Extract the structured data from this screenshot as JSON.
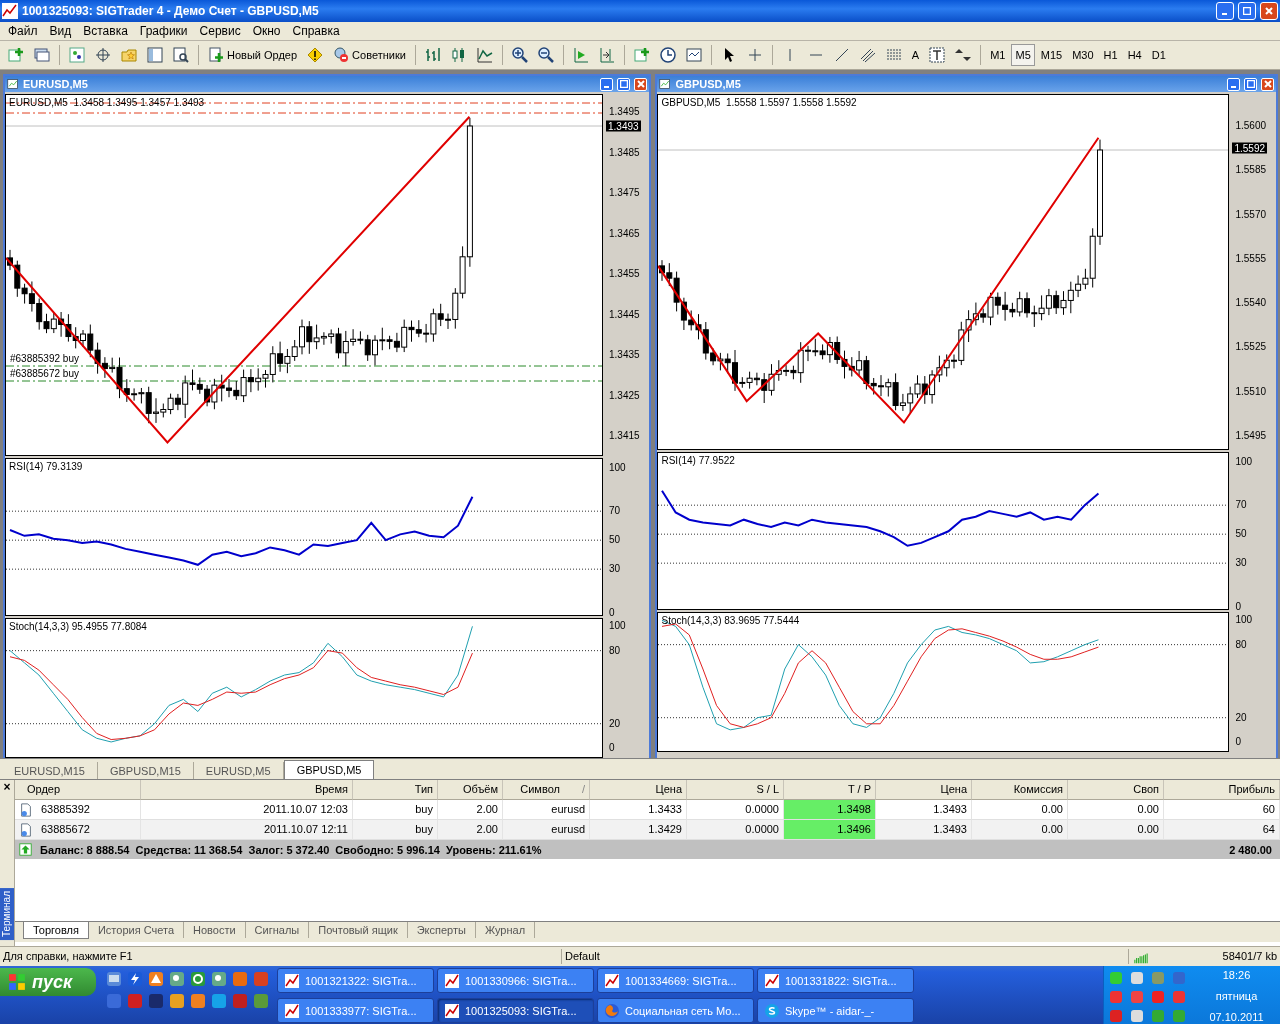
{
  "window": {
    "title": "1001325093: SIGTrader 4 - Демо Счет - GBPUSD,M5"
  },
  "menu": [
    "Файл",
    "Вид",
    "Вставка",
    "Графики",
    "Сервис",
    "Окно",
    "Справка"
  ],
  "toolbar": {
    "new_order": "Новый Ордер",
    "advisors": "Советники",
    "fonts_label": "A",
    "timeframes": [
      {
        "label": "M1",
        "selected": false
      },
      {
        "label": "M5",
        "selected": true
      },
      {
        "label": "M15",
        "selected": false
      },
      {
        "label": "M30",
        "selected": false
      },
      {
        "label": "H1",
        "selected": false
      },
      {
        "label": "H4",
        "selected": false
      },
      {
        "label": "D1",
        "selected": false
      }
    ]
  },
  "charts": [
    {
      "title": "EURUSD,M5",
      "header": "EURUSD,M5  1.3458 1.3495 1.3457 1.3493",
      "price_labels": [
        "1.3495",
        "1.3485",
        "1.3475",
        "1.3465",
        "1.3455",
        "1.3445",
        "1.3435",
        "1.3425",
        "1.3415"
      ],
      "current_price": "1.3493",
      "order_lines": [
        "#63885392 buy",
        "#63885672 buy"
      ],
      "rsi": {
        "header": "RSI(14) 79.3139",
        "chart_data": {
          "type": "line",
          "grid": true,
          "ylim": [
            -3,
            106
          ],
          "yticks": [
            {
              "value": 100,
              "label": "100"
            },
            {
              "value": 70,
              "label": "70"
            },
            {
              "value": 50,
              "label": "50"
            },
            {
              "value": 30,
              "label": "30"
            },
            {
              "value": 0,
              "label": "0"
            }
          ],
          "series": [
            {
              "color": "#0000cc",
              "values": [
                57,
                53,
                54,
                51,
                50,
                48,
                49,
                47,
                44,
                42,
                40,
                38,
                36,
                33,
                40,
                42,
                39,
                41,
                45,
                43,
                40,
                47,
                46,
                48,
                50,
                62,
                50,
                54,
                56,
                53,
                52,
                60,
                80
              ]
            }
          ]
        }
      },
      "stoch": {
        "header": "Stoch(14,3,3) 95.4955 77.8084",
        "chart_data": {
          "type": "line",
          "grid": true,
          "ylim": [
            -9,
            106
          ],
          "yticks": [
            {
              "value": 100,
              "label": "100"
            },
            {
              "value": 80,
              "label": "80"
            },
            {
              "value": 20,
              "label": "20"
            },
            {
              "value": 0,
              "label": "0"
            }
          ],
          "series": [
            {
              "color": "#20a0b0",
              "values": [
                80,
                70,
                60,
                45,
                30,
                15,
                8,
                5,
                8,
                10,
                20,
                35,
                40,
                30,
                45,
                50,
                42,
                48,
                55,
                60,
                62,
                70,
                86,
                75,
                60,
                55,
                52,
                50,
                48,
                45,
                42,
                60,
                100
              ]
            },
            {
              "color": "#e02020",
              "values": [
                75,
                72,
                64,
                52,
                40,
                25,
                12,
                7,
                8,
                10,
                15,
                28,
                37,
                35,
                40,
                46,
                45,
                46,
                52,
                57,
                60,
                66,
                80,
                78,
                66,
                58,
                55,
                52,
                50,
                47,
                44,
                50,
                78
              ]
            }
          ]
        }
      }
    },
    {
      "title": "GBPUSD,M5",
      "header": "GBPUSD,M5  1.5558 1.5597 1.5558 1.5592",
      "price_labels": [
        "1.5600",
        "1.5585",
        "1.5570",
        "1.5555",
        "1.5540",
        "1.5525",
        "1.5510",
        "1.5495"
      ],
      "current_price": "1.5592",
      "rsi": {
        "header": "RSI(14) 77.9522",
        "chart_data": {
          "type": "line",
          "grid": true,
          "ylim": [
            -3,
            106
          ],
          "yticks": [
            {
              "value": 100,
              "label": "100"
            },
            {
              "value": 70,
              "label": "70"
            },
            {
              "value": 50,
              "label": "50"
            },
            {
              "value": 30,
              "label": "30"
            },
            {
              "value": 0,
              "label": "0"
            }
          ],
          "series": [
            {
              "color": "#0000cc",
              "values": [
                80,
                65,
                60,
                58,
                57,
                56,
                60,
                57,
                55,
                58,
                56,
                60,
                58,
                57,
                56,
                55,
                52,
                48,
                42,
                44,
                48,
                52,
                60,
                62,
                66,
                64,
                62,
                65,
                60,
                62,
                60,
                70,
                78
              ]
            }
          ]
        }
      },
      "stoch": {
        "header": "Stoch(14,3,3) 83.9695 77.5444",
        "chart_data": {
          "type": "line",
          "grid": true,
          "ylim": [
            -9,
            106
          ],
          "yticks": [
            {
              "value": 100,
              "label": "100"
            },
            {
              "value": 80,
              "label": "80"
            },
            {
              "value": 20,
              "label": "20"
            },
            {
              "value": 0,
              "label": "0"
            }
          ],
          "series": [
            {
              "color": "#20a0b0",
              "values": [
                100,
                95,
                80,
                45,
                15,
                10,
                12,
                20,
                22,
                60,
                80,
                70,
                55,
                30,
                15,
                12,
                20,
                40,
                65,
                80,
                92,
                95,
                90,
                88,
                85,
                80,
                75,
                65,
                66,
                70,
                75,
                80,
                84
              ]
            },
            {
              "color": "#e02020",
              "values": [
                95,
                97,
                88,
                60,
                30,
                15,
                12,
                15,
                20,
                40,
                65,
                75,
                65,
                45,
                25,
                15,
                15,
                30,
                50,
                70,
                85,
                92,
                93,
                90,
                87,
                83,
                78,
                72,
                68,
                68,
                70,
                74,
                78
              ]
            }
          ]
        }
      }
    }
  ],
  "chart_tabs": [
    {
      "label": "EURUSD,M15",
      "selected": false
    },
    {
      "label": "GBPUSD,M15",
      "selected": false
    },
    {
      "label": "EURUSD,M5",
      "selected": false
    },
    {
      "label": "GBPUSD,M5",
      "selected": true
    }
  ],
  "terminal": {
    "side_label": "Терминал",
    "close": "×",
    "columns": [
      {
        "label": "Ордер",
        "highlight": false
      },
      {
        "label": "Время",
        "highlight": false
      },
      {
        "label": "Тип",
        "highlight": false
      },
      {
        "label": "Объём",
        "highlight": false
      },
      {
        "label": "Символ",
        "sort_mark": "/",
        "highlight": false
      },
      {
        "label": "Цена",
        "highlight": false
      },
      {
        "label": "S / L",
        "highlight": false
      },
      {
        "label": "T / P",
        "highlight": true
      },
      {
        "label": "Цена",
        "highlight": false
      },
      {
        "label": "Комиссия",
        "highlight": false
      },
      {
        "label": "Своп",
        "highlight": false
      },
      {
        "label": "Прибыль",
        "highlight": false
      }
    ],
    "rows": [
      [
        "63885392",
        "2011.10.07 12:03",
        "buy",
        "2.00",
        "eurusd",
        "1.3433",
        "0.0000",
        "1.3498",
        "1.3493",
        "0.00",
        "0.00",
        "60"
      ],
      [
        "63885672",
        "2011.10.07 12:11",
        "buy",
        "2.00",
        "eurusd",
        "1.3429",
        "0.0000",
        "1.3496",
        "1.3493",
        "0.00",
        "0.00",
        "64"
      ]
    ],
    "summary": "Баланс: 8 888.54  Средства: 11 368.54  Залог: 5 372.40  Свободно: 5 996.14  Уровень: 211.61%",
    "total": "2 480.00",
    "tabs": [
      {
        "label": "Торговля",
        "selected": true
      },
      {
        "label": "История Счета",
        "selected": false
      },
      {
        "label": "Новости",
        "selected": false
      },
      {
        "label": "Сигналы",
        "selected": false
      },
      {
        "label": "Почтовый ящик",
        "selected": false
      },
      {
        "label": "Эксперты",
        "selected": false
      },
      {
        "label": "Журнал",
        "selected": false
      }
    ]
  },
  "status_bar": {
    "help": "Для справки, нажмите F1",
    "profile": "Default",
    "traffic": "58401/7 kb"
  },
  "taskbar": {
    "start": "пуск",
    "tasks": [
      {
        "label": "1001321322: SIGTra...",
        "kind": "chart",
        "selected": false
      },
      {
        "label": "1001330966: SIGTra...",
        "kind": "chart",
        "selected": false
      },
      {
        "label": "1001334669: SIGTra...",
        "kind": "chart",
        "selected": false
      },
      {
        "label": "1001331822: SIGTra...",
        "kind": "chart",
        "selected": false
      },
      {
        "label": "1001333977: SIGTra...",
        "kind": "chart",
        "selected": false
      },
      {
        "label": "1001325093: SIGTra...",
        "kind": "chart",
        "selected": true
      },
      {
        "label": "Социальная сеть Мо...",
        "kind": "browser",
        "selected": false
      },
      {
        "label": "Skype™ - aidar-_-",
        "kind": "skype",
        "selected": false
      }
    ],
    "clock": {
      "time": "18:26",
      "day": "пятница",
      "date": "07.10.2011"
    }
  }
}
